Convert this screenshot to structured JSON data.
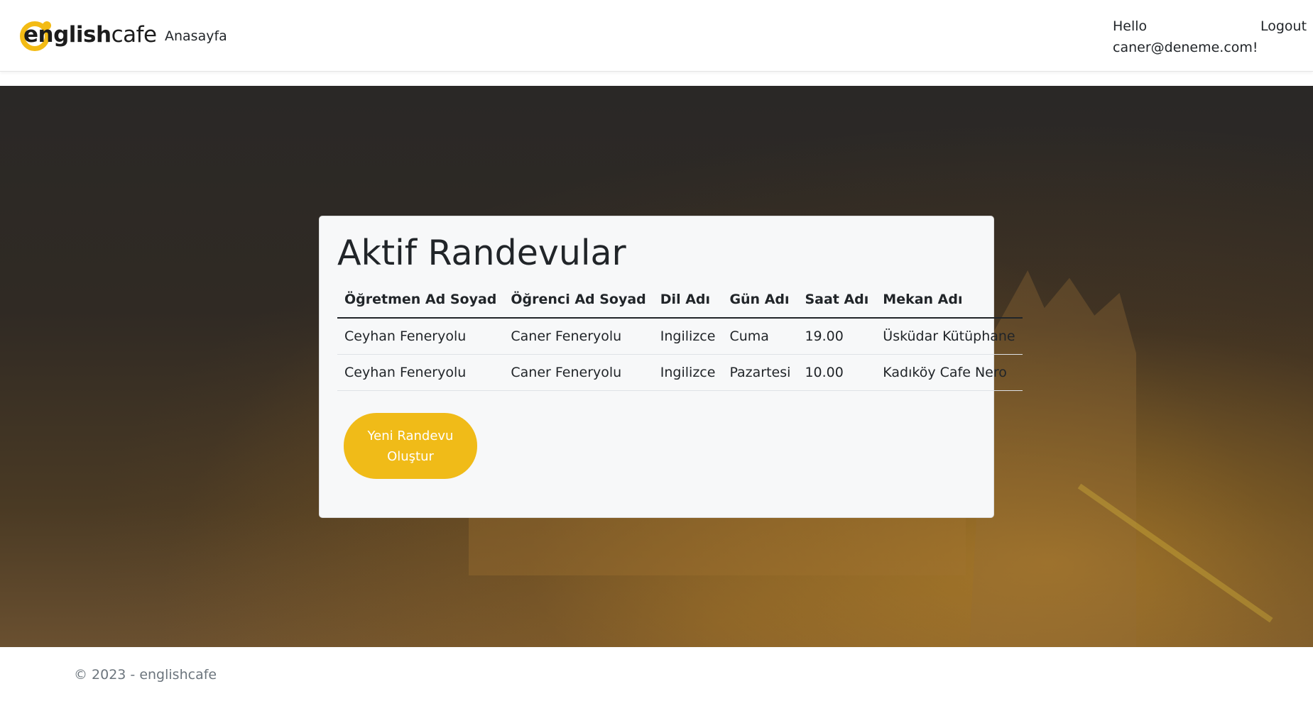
{
  "navbar": {
    "brand_bold": "english",
    "brand_light": "cafe",
    "home_link": "Anasayfa",
    "greeting": "Hello caner@deneme.com!",
    "logout": "Logout"
  },
  "card": {
    "title": "Aktif Randevular",
    "columns": [
      "Öğretmen Ad Soyad",
      "Öğrenci Ad Soyad",
      "Dil Adı",
      "Gün Adı",
      "Saat Adı",
      "Mekan Adı"
    ],
    "rows": [
      [
        "Ceyhan Feneryolu",
        "Caner Feneryolu",
        "Ingilizce",
        "Cuma",
        "19.00",
        "Üsküdar Kütüphane"
      ],
      [
        "Ceyhan Feneryolu",
        "Caner Feneryolu",
        "Ingilizce",
        "Pazartesi",
        "10.00",
        "Kadıköy Cafe Nero"
      ]
    ],
    "new_button": "Yeni Randevu Oluştur"
  },
  "footer": {
    "text": "© 2023 - englishcafe"
  },
  "colors": {
    "accent": "#f0bb18",
    "text": "#212529",
    "footer_text": "#6c757d"
  }
}
